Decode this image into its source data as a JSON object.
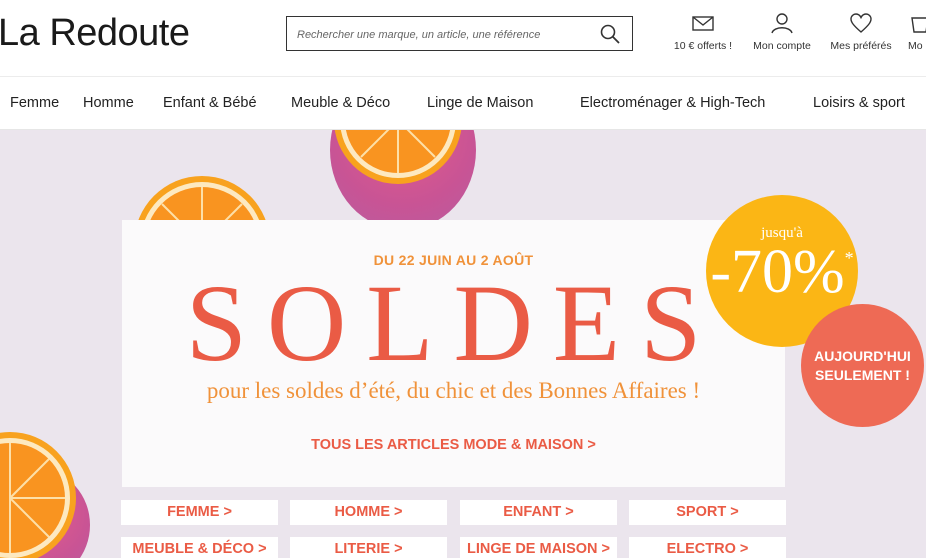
{
  "header": {
    "logo": "La Redoute",
    "search_placeholder": "Rechercher une marque, un article, une référence",
    "links": [
      {
        "label": "10 € offerts !",
        "icon": "envelope-icon"
      },
      {
        "label": "Mon compte",
        "icon": "user-icon"
      },
      {
        "label": "Mes préférés",
        "icon": "heart-icon"
      },
      {
        "label": "Mo",
        "icon": "cart-icon"
      }
    ]
  },
  "nav": {
    "items": [
      "Femme",
      "Homme",
      "Enfant & Bébé",
      "Meuble & Déco",
      "Linge de Maison",
      "Electroménager & High-Tech",
      "Loisirs & sport"
    ]
  },
  "hero": {
    "dates": "DU 22 JUIN AU 2 AOÛT",
    "title": "SOLDES",
    "tagline": "pour les soldes d’été, du chic et des Bonnes Affaires !",
    "cta": "TOUS LES ARTICLES MODE & MAISON >",
    "badge": {
      "up_to": "jusqu'à",
      "percent": "-70%",
      "asterisk": "*"
    },
    "today": "AUJOURD'HUI SEULEMENT !",
    "categories": [
      "FEMME >",
      "HOMME >",
      "ENFANT >",
      "SPORT >",
      "MEUBLE & DÉCO >",
      "LITERIE >",
      "LINGE DE MAISON >",
      "ELECTRO >"
    ]
  },
  "colors": {
    "accent_red": "#ea5b45",
    "accent_orange": "#f0923a",
    "badge_yellow": "#fbb615",
    "hero_bg": "#ebe5ed"
  }
}
